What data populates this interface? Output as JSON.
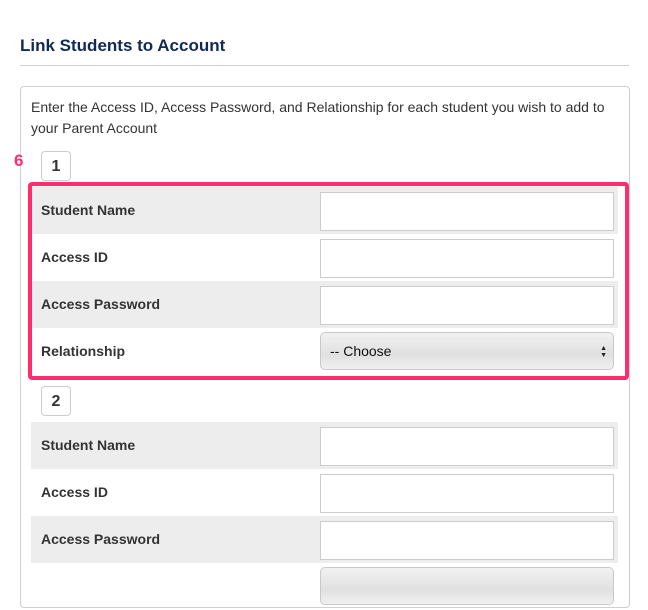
{
  "page": {
    "title": "Link Students to Account",
    "intro": "Enter the Access ID, Access Password, and Relationship for each student you wish to add to your Parent Account"
  },
  "annotation": {
    "marker_label": "6",
    "highlight_color": "#ff2d6f"
  },
  "students": [
    {
      "number": "1",
      "fields": {
        "student_name": {
          "label": "Student Name",
          "value": ""
        },
        "access_id": {
          "label": "Access ID",
          "value": ""
        },
        "access_password": {
          "label": "Access Password",
          "value": ""
        },
        "relationship": {
          "label": "Relationship",
          "selected": "-- Choose"
        }
      }
    },
    {
      "number": "2",
      "fields": {
        "student_name": {
          "label": "Student Name",
          "value": ""
        },
        "access_id": {
          "label": "Access ID",
          "value": ""
        },
        "access_password": {
          "label": "Access Password",
          "value": ""
        }
      }
    }
  ]
}
